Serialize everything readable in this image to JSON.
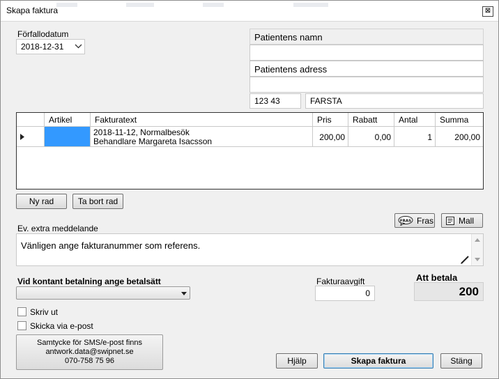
{
  "window": {
    "title": "Skapa faktura",
    "close_glyph": "⊠"
  },
  "due_date": {
    "label": "Förfallodatum",
    "value": "2018-12-31"
  },
  "patient": {
    "name_label": "Patientens namn",
    "name_value": "",
    "address_label": "Patientens adress",
    "address_value": "",
    "postal_code": "123 43",
    "city": "FARSTA"
  },
  "grid": {
    "columns": [
      "Artikel",
      "Fakturatext",
      "Pris",
      "Rabatt",
      "Antal",
      "Summa"
    ],
    "rows": [
      {
        "artikel": "",
        "text_line1": "2018-11-12, Normalbesök",
        "text_line2": "Behandlare Margareta Isacsson",
        "pris": "200,00",
        "rabatt": "0,00",
        "antal": "1",
        "summa": "200,00"
      }
    ]
  },
  "row_buttons": {
    "add": "Ny rad",
    "remove": "Ta bort rad"
  },
  "text_buttons": {
    "phrase": "Fras",
    "template": "Mall",
    "phrase_icon_text": "FRAS"
  },
  "message": {
    "label": "Ev. extra meddelande",
    "value": "Vänligen ange fakturanummer som referens."
  },
  "payment": {
    "label": "Vid kontant betalning ange betalsätt",
    "value": ""
  },
  "fee": {
    "label": "Fakturaavgift",
    "value": "0"
  },
  "total": {
    "label": "Att betala",
    "value": "200"
  },
  "options": {
    "print": "Skriv ut",
    "email": "Skicka via e-post",
    "print_checked": false,
    "email_checked": false
  },
  "consent": {
    "line1": "Samtycke för SMS/e-post finns",
    "line2": "antwork.data@swipnet.se",
    "line3": "070-758 75 96"
  },
  "footer": {
    "help": "Hjälp",
    "create": "Skapa faktura",
    "close": "Stäng"
  },
  "colors": {
    "accent": "#3399ff",
    "window_bg": "#f0f0f0"
  },
  "icons": [
    "close-icon",
    "chevron-down-icon",
    "row-indicator-icon",
    "phrase-icon",
    "template-icon",
    "edit-pencil-icon",
    "scroll-up-icon",
    "scroll-down-icon"
  ]
}
